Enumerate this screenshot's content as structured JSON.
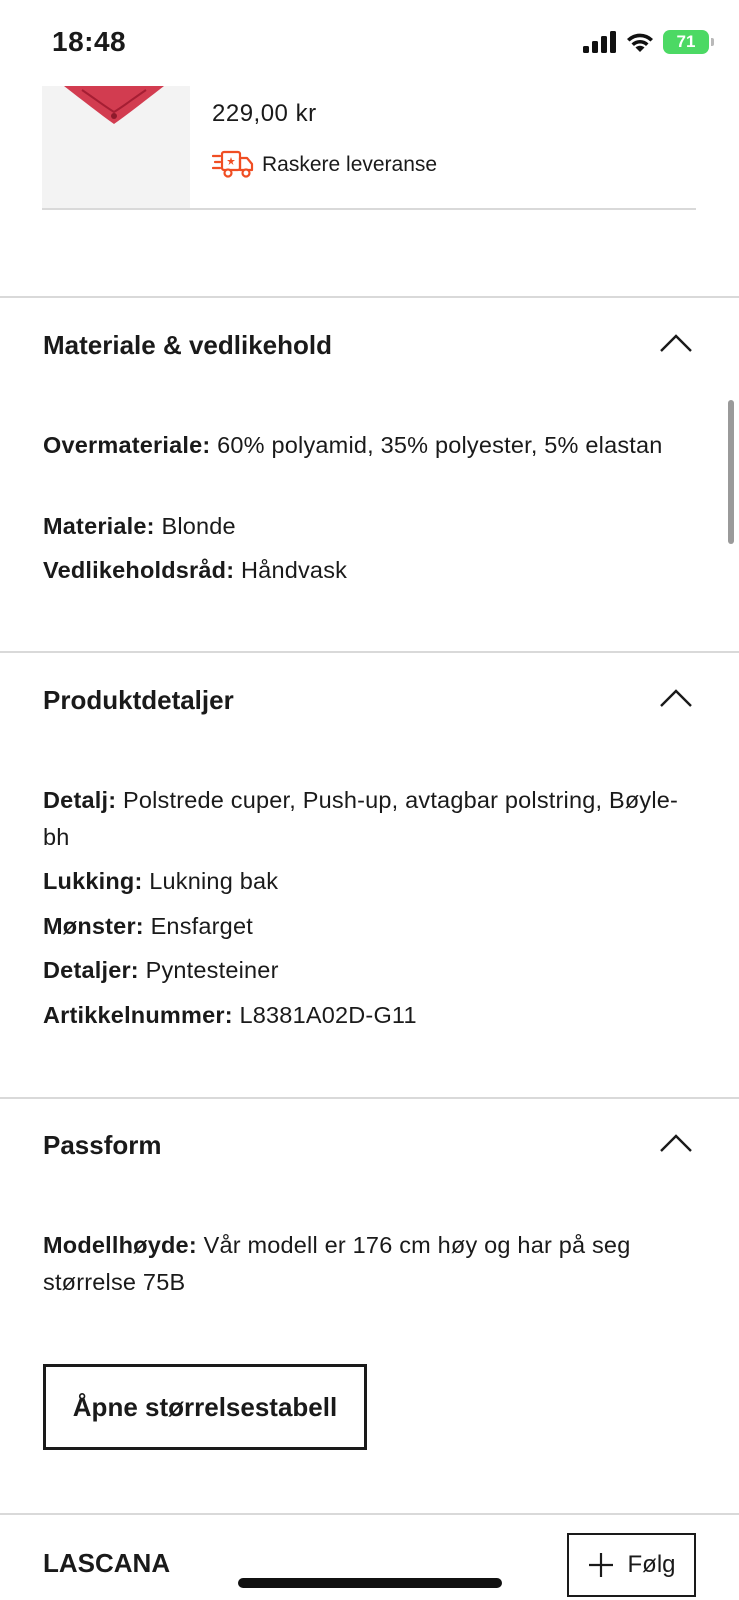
{
  "status_bar": {
    "time": "18:48",
    "battery": "71"
  },
  "product": {
    "price": "229,00 kr",
    "delivery_label": "Raskere leveranse"
  },
  "sections": {
    "material": {
      "title": "Materiale & vedlikehold",
      "fields": [
        {
          "label": "Overmateriale:",
          "value": "60% polyamid, 35% polyester, 5% elastan"
        },
        {
          "label": "Materiale:",
          "value": "Blonde"
        },
        {
          "label": "Vedlikeholdsråd:",
          "value": "Håndvask"
        }
      ]
    },
    "details": {
      "title": "Produktdetaljer",
      "fields": [
        {
          "label": "Detalj:",
          "value": "Polstrede cuper, Push-up, avtagbar polstring, Bøyle-bh"
        },
        {
          "label": "Lukking:",
          "value": "Lukning bak"
        },
        {
          "label": "Mønster:",
          "value": "Ensfarget"
        },
        {
          "label": "Detaljer:",
          "value": "Pyntesteiner"
        },
        {
          "label": "Artikkelnummer:",
          "value": "L8381A02D-G11"
        }
      ]
    },
    "fit": {
      "title": "Passform",
      "fields": [
        {
          "label": "Modellhøyde:",
          "value": "Vår modell er 176 cm høy og har på seg størrelse 75B"
        }
      ],
      "size_table_button": "Åpne størrelsestabell"
    }
  },
  "brand": {
    "name": "LASCANA",
    "follow_label": "Følg"
  },
  "colors": {
    "accent_orange": "#f04e23",
    "text": "#1a1a1a",
    "divider": "#d9d9d9",
    "battery_green": "#4cd964"
  }
}
